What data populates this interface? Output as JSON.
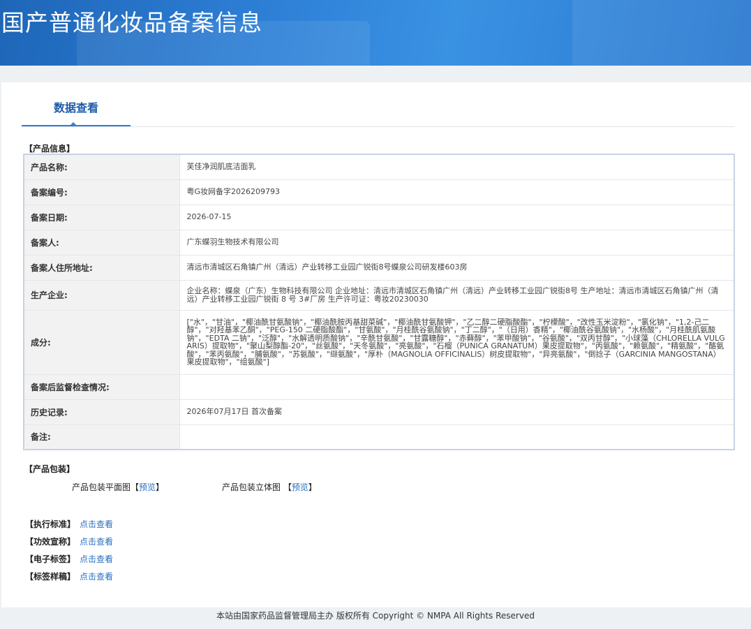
{
  "header": {
    "title": "国产普通化妆品备案信息"
  },
  "tabs": [
    {
      "label": "数据查看",
      "active": true
    }
  ],
  "product_info": {
    "section_label": "【产品信息】",
    "rows": [
      {
        "key": "产品名称:",
        "value": "芙佳净润肌底洁面乳"
      },
      {
        "key": "备案编号:",
        "value": "粤G妆网备字2026209793"
      },
      {
        "key": "备案日期:",
        "value": "2026-07-15"
      },
      {
        "key": "备案人:",
        "value": "广东蝶羽生物技术有限公司"
      },
      {
        "key": "备案人住所地址:",
        "value": "清远市清城区石角镇广州（清远）产业转移工业园广锐街8号蝶泉公司研发楼603房"
      },
      {
        "key": "生产企业:",
        "value": "企业名称：蝶泉（广东）生物科技有限公司 企业地址：清远市清城区石角镇广州（清远）产业转移工业园广锐街8号 生产地址：清远市清城区石角镇广州（清远）产业转移工业园广锐街 8 号 3#厂房 生产许可证：粤妆20230030"
      },
      {
        "key": "成分:",
        "value": "[\"水\"，\"甘油\"，\"椰油酰甘氨酸钠\"，\"椰油酰胺丙基甜菜碱\"，\"椰油酰甘氨酸钾\"，\"乙二醇二硬脂酸酯\"，\"柠檬酸\"，\"改性玉米淀粉\"，\"氯化钠\"，\"1,2-己二醇\"，\"对羟基苯乙酮\"，\"PEG-150 二硬脂酸酯\"，\"甘氨酸\"，\"月桂酰谷氨酸钠\"，\"丁二醇\"，\"（日用）香精\"，\"椰油酰谷氨酸钠\"，\"水杨酸\"，\"月桂酰肌氨酸钠\"，\"EDTA 二钠\"，\"泛醇\"，\"水解透明质酸钠\"，\"辛酰甘氨酸\"，\"甘露糖醇\"，\"赤藓醇\"，\"苯甲酸钠\"，\"谷氨酸\"，\"双丙甘醇\"，\"小球藻（CHLORELLA VULGARIS）提取物\"，\"聚山梨醇酯-20\"，\"丝氨酸\"，\"天冬氨酸\"，\"亮氨酸\"，\"石榴（PUNICA GRANATUM）果皮提取物\"，\"丙氨酸\"，\"赖氨酸\"，\"精氨酸\"，\"酪氨酸\"，\"苯丙氨酸\"，\"脯氨酸\"，\"苏氨酸\"，\"缬氨酸\"，\"厚朴（MAGNOLIA OFFICINALIS）树皮提取物\"，\"异亮氨酸\"，\"倒捻子（GARCINIA MANGOSTANA）果皮提取物\"，\"组氨酸\"]"
      },
      {
        "key": "备案后监督检查情况:",
        "value": ""
      },
      {
        "key": "历史记录:",
        "value": "2026年07月17日 首次备案"
      },
      {
        "key": "备注:",
        "value": ""
      }
    ]
  },
  "packaging": {
    "section_label": "【产品包装】",
    "flat_label": "产品包装平面图",
    "solid_label": "产品包装立体图",
    "bracket_open": "【",
    "bracket_close": "】",
    "preview": "预览"
  },
  "links": [
    {
      "label": "【执行标准】",
      "link": "点击查看"
    },
    {
      "label": "【功效宣称】",
      "link": "点击查看"
    },
    {
      "label": "【电子标签】",
      "link": "点击查看"
    },
    {
      "label": "【标签样稿】",
      "link": "点击查看"
    }
  ],
  "footer": {
    "text": "本站由国家药品监督管理局主办 版权所有 Copyright © NMPA All Rights Reserved"
  }
}
